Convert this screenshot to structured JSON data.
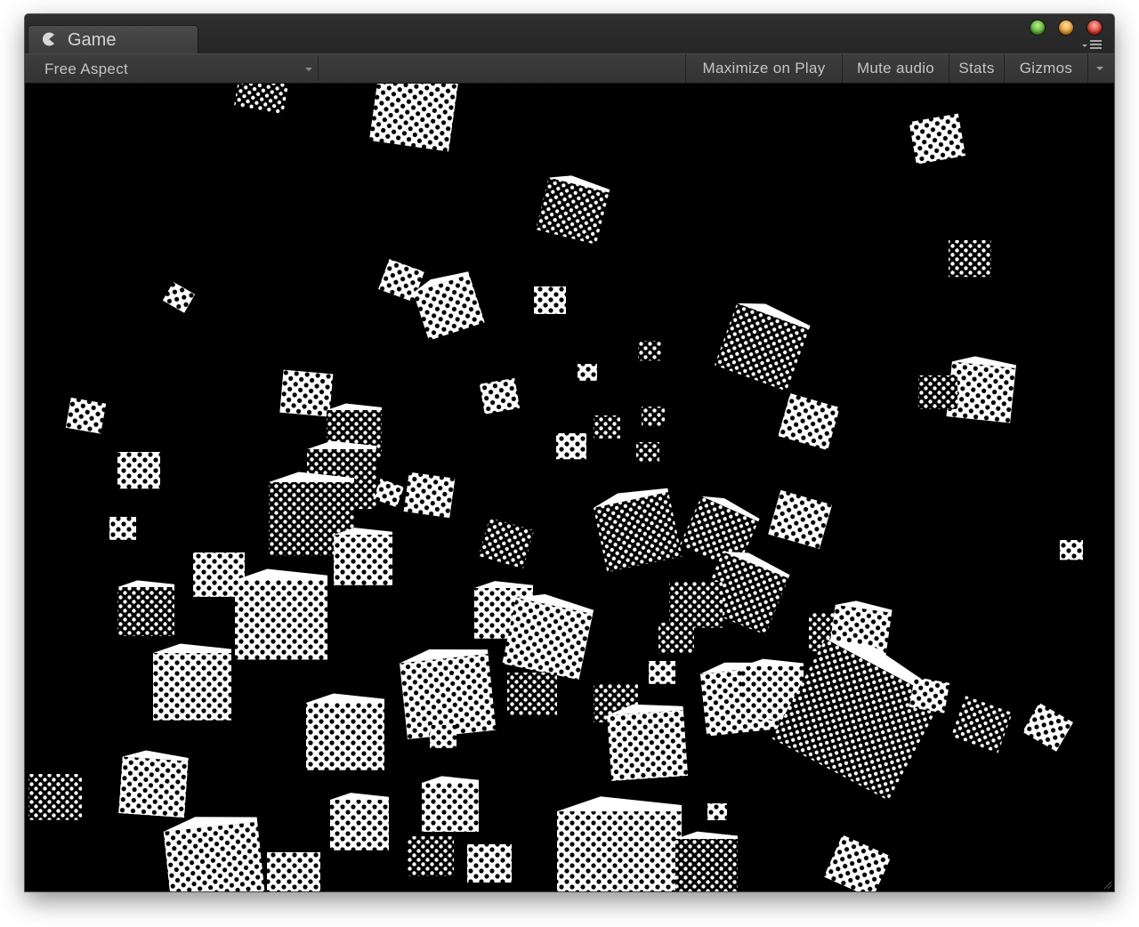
{
  "window": {
    "tab_title": "Game",
    "tab_icon": "pacman-icon",
    "window_controls": [
      "green",
      "yellow",
      "red"
    ]
  },
  "toolbar": {
    "aspect_label": "Free Aspect",
    "maximize_label": "Maximize on Play",
    "mute_label": "Mute audio",
    "stats_label": "Stats",
    "gizmos_label": "Gizmos"
  },
  "viewport": {
    "scene": "halftone-checkered-cubes",
    "background_color": "#000000",
    "foreground_color": "#ffffff"
  }
}
